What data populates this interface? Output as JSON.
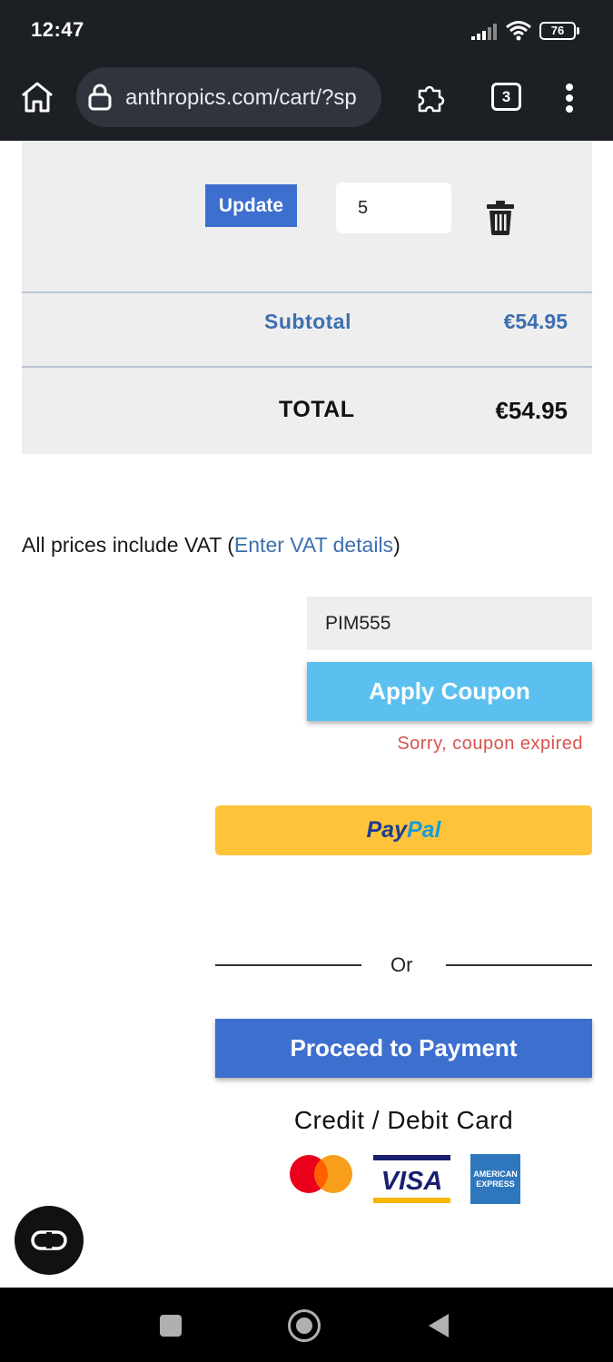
{
  "status_bar": {
    "time": "12:47",
    "battery_level": "76",
    "signal_icon": "cellular-signal-icon",
    "wifi_icon": "wifi-icon"
  },
  "browser": {
    "url": "anthropics.com/cart/?sp",
    "tab_count": "3",
    "home_icon": "home-icon",
    "lock_icon": "lock-icon",
    "extensions_icon": "puzzle-icon",
    "menu_icon": "more-vert-icon"
  },
  "cart": {
    "update_label": "Update",
    "quantity": "5",
    "delete_icon": "trash-icon",
    "subtotal_label": "Subtotal",
    "subtotal_value": "€54.95",
    "total_label": "TOTAL",
    "total_value": "€54.95"
  },
  "vat": {
    "prefix": "All prices include VAT (",
    "link": "Enter VAT details",
    "suffix": ")"
  },
  "coupon": {
    "code": "PIM555",
    "apply_label": "Apply Coupon",
    "error": "Sorry, coupon expired"
  },
  "paypal": {
    "label_pay": "Pay",
    "label_pal": "Pal"
  },
  "checkout": {
    "or_label": "Or",
    "proceed_label": "Proceed to Payment",
    "card_label": "Credit / Debit Card",
    "visa_text": "VISA",
    "amex_text_1": "AMERICAN",
    "amex_text_2": "EXPRESS"
  },
  "colors": {
    "primary_blue": "#3d6fcf",
    "link_blue": "#3d6fb0",
    "coupon_button": "#5bc0f0",
    "error_red": "#d9534f",
    "paypal_yellow": "#ffc33a"
  }
}
